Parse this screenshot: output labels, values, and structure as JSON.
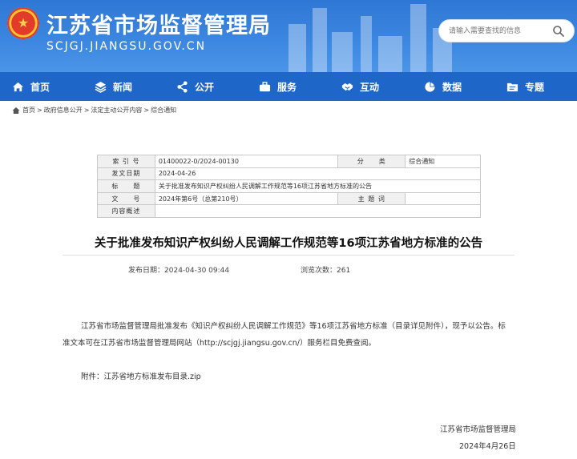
{
  "site": {
    "title": "江苏省市场监督管理局",
    "subtitle": "SCJGJ.JIANGSU.GOV.CN"
  },
  "search": {
    "placeholder": "请输入需要查找的信息"
  },
  "nav": {
    "items": [
      {
        "label": "首页",
        "icon": "home-icon"
      },
      {
        "label": "新闻",
        "icon": "layers-icon"
      },
      {
        "label": "公开",
        "icon": "share-icon"
      },
      {
        "label": "服务",
        "icon": "briefcase-icon"
      },
      {
        "label": "互动",
        "icon": "handshake-icon"
      },
      {
        "label": "数据",
        "icon": "pie-chart-icon"
      },
      {
        "label": "专题",
        "icon": "folder-icon"
      }
    ]
  },
  "breadcrumb": [
    "首页",
    "政府信息公开",
    "法定主动公开内容",
    "综合通知"
  ],
  "info": {
    "index_label": "索 引 号",
    "index_value": "01400022-0/2024-00130",
    "category_label": "分　　类",
    "category_value": "综合通知",
    "date_label": "发文日期",
    "date_value": "2024-04-26",
    "subject_label": "标　　题",
    "subject_value": "关于批准发布知识产权纠纷人民调解工作规范等16项江苏省地方标准的公告",
    "docno_label": "文　　号",
    "docno_value": "2024年第6号（总第210号）",
    "keywords_label": "主 题 词",
    "keywords_value": "",
    "summary_label": "内容概述",
    "summary_value": ""
  },
  "article": {
    "title": "关于批准发布知识产权纠纷人民调解工作规范等16项江苏省地方标准的公告",
    "publish_label": "发布日期：",
    "publish_date": "2024-04-30 09:44",
    "views_label": "浏览次数：",
    "views": "261",
    "para1_line1": "江苏省市场监督管理局批准发布《知识产权纠纷人民调解工作规范》等16项江苏省地方标准（目录详见附件），现予以公告。标",
    "para1_line2": "准文本可在江苏省市场监督管理局网站（http://scjgj.jiangsu.gov.cn/）服务栏目免费查阅。",
    "attachment_label": "附件：",
    "attachment_name": "江苏省地方标准发布目录.zip",
    "signature_org": "江苏省市场监督管理局",
    "signature_date": "2024年4月26日"
  }
}
